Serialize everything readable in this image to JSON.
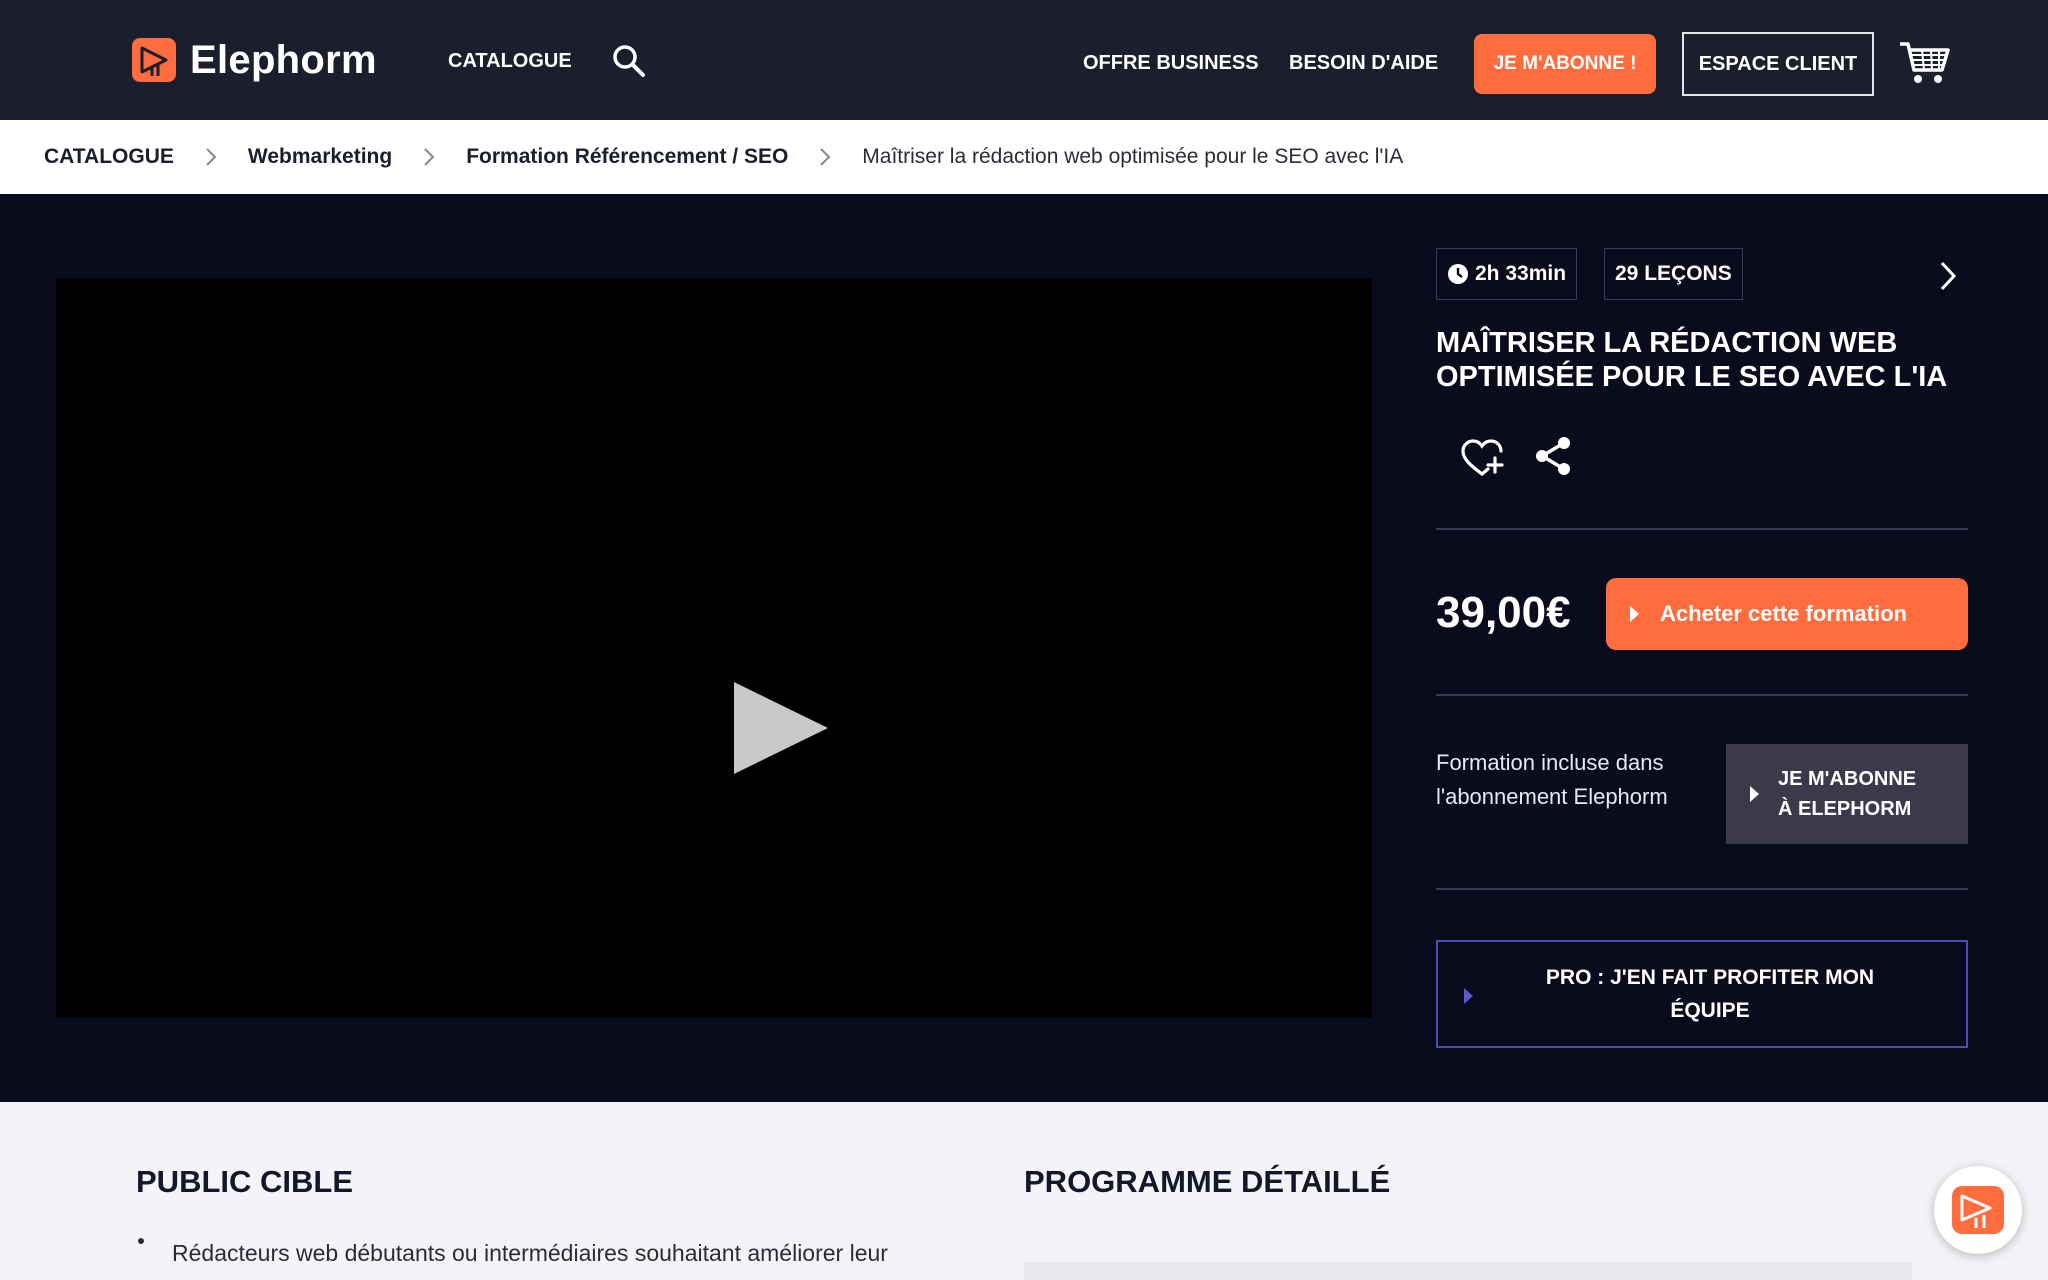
{
  "header": {
    "logo_text": "Elephorm",
    "nav_catalogue": "CATALOGUE",
    "nav_offre_business": "OFFRE BUSINESS",
    "nav_besoin_aide": "BESOIN D'AIDE",
    "btn_abonne": "JE M'ABONNE !",
    "btn_espace_client": "ESPACE CLIENT"
  },
  "breadcrumb": {
    "items": [
      "CATALOGUE",
      "Webmarketing",
      "Formation Référencement / SEO",
      "Maîtriser la rédaction web optimisée pour le SEO avec l'IA"
    ]
  },
  "course": {
    "duration": "2h 33min",
    "lessons": "29 LEÇONS",
    "title": "MAÎTRISER LA RÉDACTION WEB OPTIMISÉE POUR LE SEO AVEC L'IA",
    "price": "39,00€",
    "buy_label": "Acheter cette formation",
    "included_text": "Formation incluse dans l'abonnement Elephorm",
    "subscribe_line1": "JE M'ABONNE",
    "subscribe_line2": "À ELEPHORM",
    "pro_line1": "PRO : J'EN FAIT PROFITER MON",
    "pro_line2": "ÉQUIPE"
  },
  "sections": {
    "public_cible_title": "PUBLIC CIBLE",
    "public_cible_item1": "Rédacteurs web débutants ou intermédiaires souhaitant améliorer leur",
    "programme_title": "PROGRAMME DÉTAILLÉ"
  },
  "colors": {
    "accent": "#ff6d3f",
    "header_bg": "#1b1e2d",
    "hero_bg": "#0b0b1e",
    "pro_border": "#4a4cb8"
  }
}
